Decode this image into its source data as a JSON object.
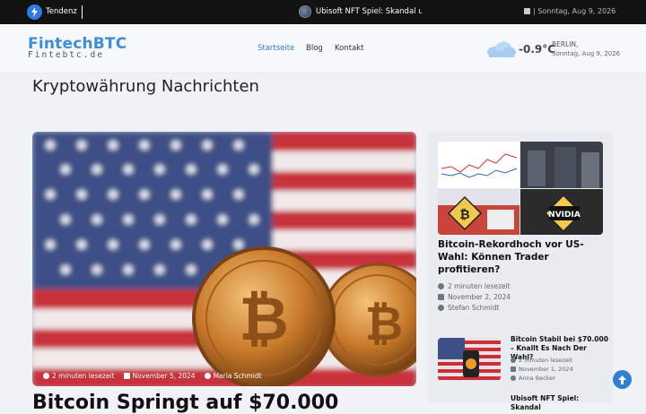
{
  "topbar": {
    "trend_label": "Tendenz",
    "news_text": "Ubisoft NFT Spiel: Skandal um NFT-Spiel",
    "date": "| Sonntag, Aug 9, 2026"
  },
  "header": {
    "logo": "FintechBTC",
    "logo_sub": "Fintebtc.de",
    "nav": [
      {
        "label": "Startseite",
        "active": true
      },
      {
        "label": "Blog",
        "active": false
      },
      {
        "label": "Kontakt",
        "active": false
      }
    ],
    "weather": {
      "temp": "-0.9°C",
      "city": "BERLIN,",
      "date": "Sonntag, Aug 9, 2026"
    }
  },
  "page_title": "Kryptowährung Nachrichten",
  "hero": {
    "read_time": "2 minuten lesezeit",
    "date": "November 5, 2024",
    "author": "Maria Schmidt",
    "headline": "Bitcoin Springt auf $70.000"
  },
  "sidebar": {
    "main": {
      "title": "Bitcoin-Rekordhoch vor US-Wahl: Können Trader profitieren?",
      "read_time": "2 minuten lesezeit",
      "date": "November 2, 2024",
      "author": "Stefan Schmidt"
    },
    "items": [
      {
        "title": "Bitcoin Stabil bei $70.000 – Knallt Es Nach Der Wahl?",
        "read_time": "2 minuten lesezeit",
        "date": "November 1, 2024",
        "author": "Anna Becker"
      },
      {
        "title": "Ubisoft NFT Spiel: Skandal"
      }
    ]
  },
  "colors": {
    "accent": "#2f7fd3",
    "topbar": "#121212"
  }
}
